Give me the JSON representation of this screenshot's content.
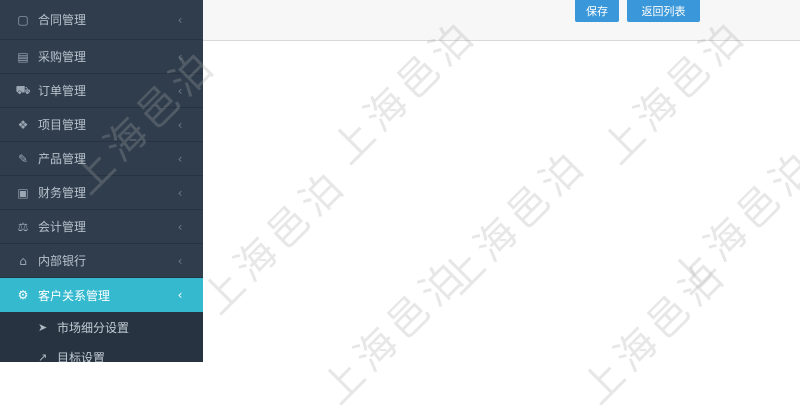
{
  "toolbar": {
    "save_label": "保存",
    "back_label": "返回列表"
  },
  "sidebar": {
    "items": [
      {
        "label": "合同管理",
        "icon": "document-icon"
      },
      {
        "label": "采购管理",
        "icon": "inbox-icon"
      },
      {
        "label": "订单管理",
        "icon": "cart-icon"
      },
      {
        "label": "项目管理",
        "icon": "cubes-icon"
      },
      {
        "label": "产品管理",
        "icon": "edit-icon"
      },
      {
        "label": "财务管理",
        "icon": "money-icon"
      },
      {
        "label": "会计管理",
        "icon": "scale-icon"
      },
      {
        "label": "内部银行",
        "icon": "bank-icon"
      },
      {
        "label": "客户关系管理",
        "icon": "cogs-icon",
        "active": true
      }
    ],
    "subitems": [
      {
        "label": "市场细分设置",
        "icon": "send-icon"
      },
      {
        "label": "目标设置",
        "icon": "arrow-icon"
      }
    ]
  },
  "watermark": {
    "text": "上海邑泊"
  },
  "colors": {
    "sidebar_bg": "#2f3d4d",
    "active_bg": "#35b9cf",
    "button_bg": "#3a97d9"
  }
}
